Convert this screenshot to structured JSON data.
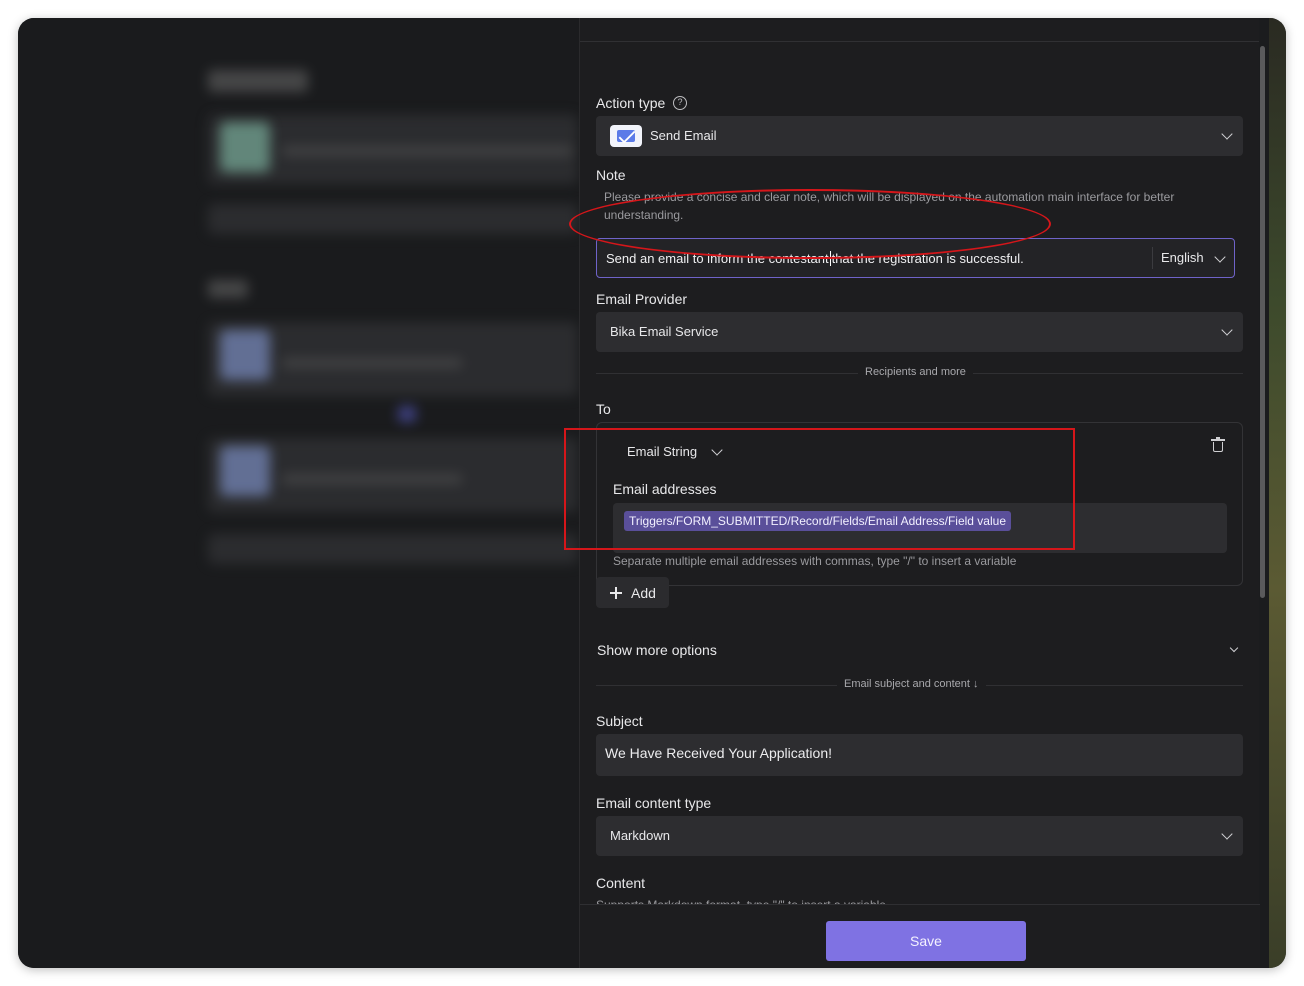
{
  "drawer": {
    "action_type": {
      "label": "Action type",
      "help_icon": "question-circle-icon",
      "value": "Send Email",
      "icon": "mail-icon"
    },
    "note": {
      "label": "Note",
      "hint": "Please provide a concise and clear note, which will be displayed on the automation main interface for better understanding.",
      "value_before_caret": "Send an email to inform the contestant",
      "value_after_caret": "that the registration is successful.",
      "language": "English"
    },
    "email_provider": {
      "label": "Email Provider",
      "value": "Bika Email Service"
    },
    "recipients_divider": "Recipients and more",
    "to": {
      "label": "To",
      "type_select": "Email String",
      "email_addresses_label": "Email addresses",
      "variable_chip": "Triggers/FORM_SUBMITTED/Record/Fields/Email Address/Field value",
      "hint": "Separate multiple email addresses with commas, type \"/\" to insert a variable",
      "delete_icon": "trash-icon"
    },
    "add_button": "Add",
    "show_more": "Show more options",
    "subject_divider": "Email subject and content ↓",
    "subject": {
      "label": "Subject",
      "value": "We Have Received Your Application!"
    },
    "content_type": {
      "label": "Email content type",
      "value": "Markdown"
    },
    "content": {
      "label": "Content",
      "hint": "Supports Markdown format, type \"/\" to insert a variable"
    },
    "save_button": "Save"
  },
  "colors": {
    "accent": "#7f72e3",
    "annotation": "#d5161a",
    "panel_bg": "#1d1d1f",
    "field_bg": "#2d2d30"
  }
}
